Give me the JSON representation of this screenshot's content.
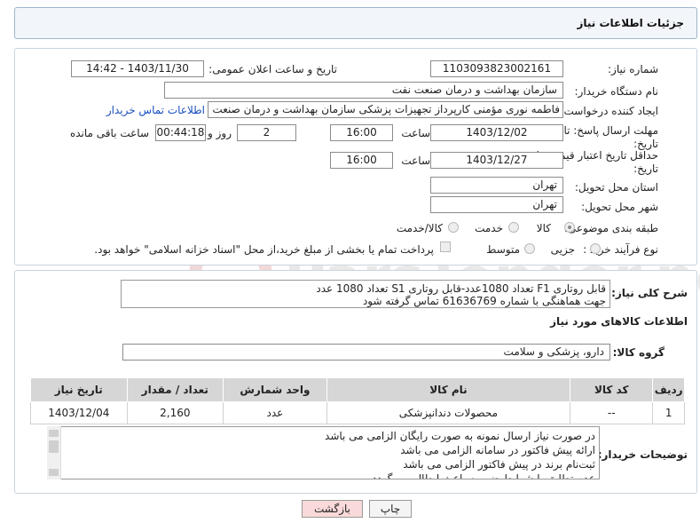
{
  "header": {
    "title": "جزئیات اطلاعات نیاز"
  },
  "form": {
    "need_number": {
      "label": "شماره نیاز:",
      "value": "1103093823002161"
    },
    "announce_datetime": {
      "label": "تاریخ و ساعت اعلان عمومی:",
      "value": "1403/11/30 - 14:42"
    },
    "buyer_org": {
      "label": "نام دستگاه خریدار:",
      "value": "سازمان بهداشت و درمان صنعت نفت"
    },
    "requester": {
      "label": "ایجاد کننده درخواست:",
      "value": "فاطمه نوری مؤمنی کارپرداز تجهیزات پزشکی سازمان بهداشت و درمان صنعت نف",
      "contact_link": "اطلاعات تماس خریدار"
    },
    "reply_deadline": {
      "label_line1": "مهلت ارسال پاسخ: تا",
      "label_line2": "تاریخ:",
      "date": "1403/12/02",
      "time_label": "ساعت",
      "time": "16:00",
      "days": "2",
      "days_label": "روز و",
      "remaining": "00:44:18",
      "remaining_label": "ساعت باقی مانده"
    },
    "price_validity": {
      "label_line1": "حداقل تاریخ اعتبار قیمت: تا",
      "label_line2": "تاریخ:",
      "date": "1403/12/27",
      "time_label": "ساعت",
      "time": "16:00"
    },
    "delivery_province": {
      "label": "استان محل تحویل:",
      "value": "تهران"
    },
    "delivery_city": {
      "label": "شهر محل تحویل:",
      "value": "تهران"
    },
    "category": {
      "label": "طبقه بندی موضوعی:",
      "options": [
        "کالا",
        "خدمت",
        "کالا/خدمت"
      ],
      "selected": "کالا"
    },
    "purchase_type": {
      "label": "نوع فرآیند خرید :",
      "options": [
        "جزیی",
        "متوسط"
      ],
      "selected": "جزیی",
      "note": "پرداخت تمام یا بخشی از مبلغ خرید،از محل \"اسناد خزانه اسلامی\" خواهد بود."
    }
  },
  "description": {
    "label": "شرح کلی نیاز:",
    "line1": "قابل روتاری F1 تعداد 1080عدد-قابل روتاری S1 تعداد 1080 عدد",
    "line2": "جهت هماهنگی با شماره 61636769 تماس گرفته شود"
  },
  "items_section": {
    "title": "اطلاعات کالاهای مورد نیاز",
    "group_label": "گروه کالا:",
    "group_value": "دارو، پزشکی و سلامت",
    "columns": [
      "ردیف",
      "کد کالا",
      "نام کالا",
      "واحد شمارش",
      "تعداد / مقدار",
      "تاریخ نیاز"
    ],
    "rows": [
      {
        "row": "1",
        "code": "--",
        "name": "محصولات دندانپزشکی",
        "unit": "عدد",
        "qty": "2,160",
        "date": "1403/12/04"
      }
    ]
  },
  "buyer_notes": {
    "label": "توضیحات خریدار:",
    "lines": [
      "در صورت نیاز ارسال نمونه به صورت رایگان الزامی می باشد",
      "ارائه پیش فاکتور در سامانه الزامی می باشد",
      "ثبت‌نام برند در پیش فاکتور الزامی می باشد",
      "عدم تطابق با شرایط ضمیمه باعث ابطال می گردد"
    ]
  },
  "buttons": {
    "print": "چاپ",
    "back": "بازگشت"
  },
  "watermark": "ParsTender.net",
  "colors": {
    "header_bg": "#f2f5f9",
    "back_button_bg": "#f9d9d9",
    "link": "#1a4fbf"
  }
}
